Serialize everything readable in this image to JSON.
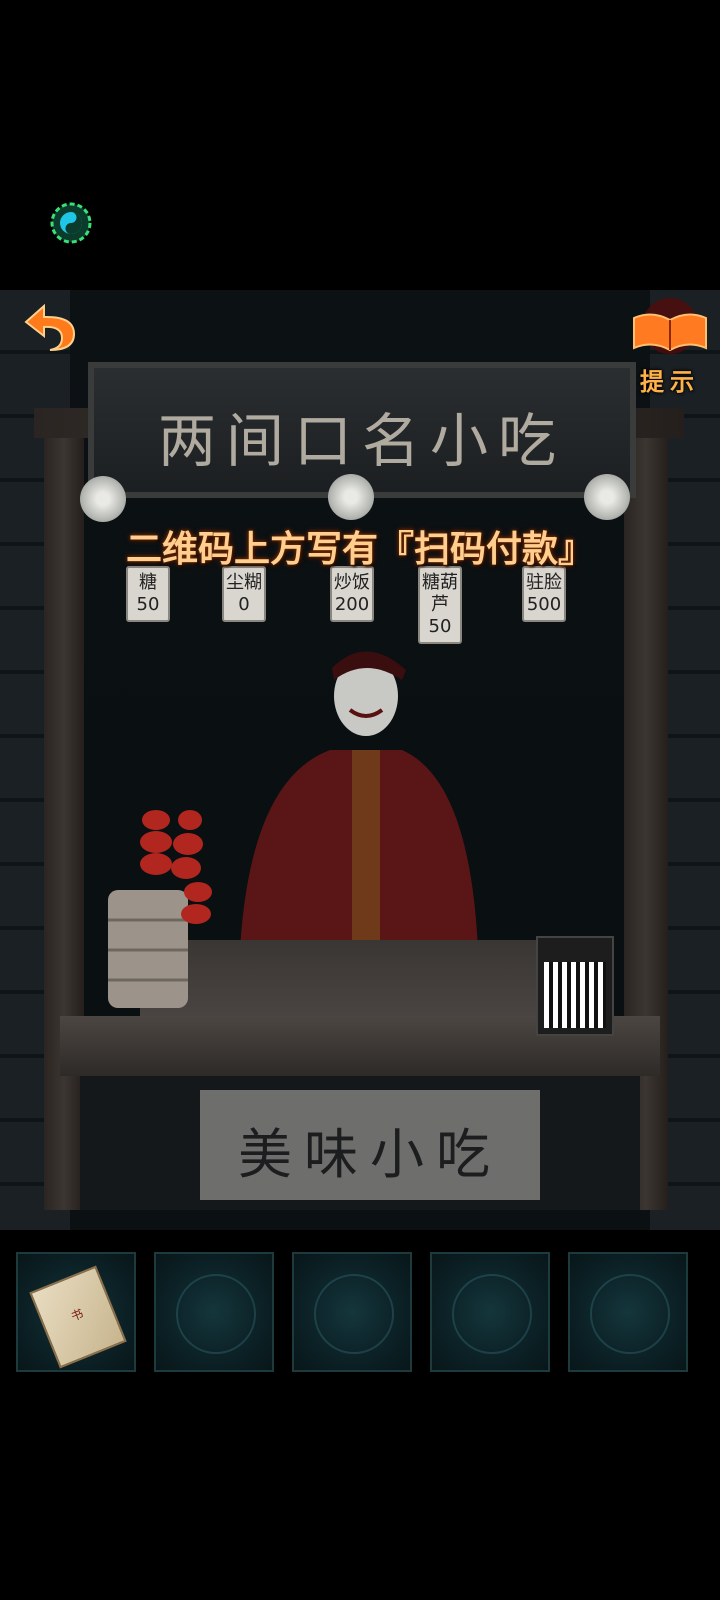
{
  "hud": {
    "settings_icon": "gear-yin-yang-icon",
    "back_icon": "back-arrow-icon",
    "hint_icon": "open-book-icon",
    "hint_label": "提示"
  },
  "scene": {
    "sign_text": "两间口名小吃",
    "menu_tags": [
      {
        "label": "糖",
        "price": "50"
      },
      {
        "label": "尘糊",
        "price": "0"
      },
      {
        "label": "炒饭",
        "price": "200"
      },
      {
        "label": "糖葫芦",
        "price": "50"
      },
      {
        "label": "驻脸",
        "price": "500"
      }
    ],
    "poster_text": "美味小吃",
    "message": "二维码上方写有『扫码付款』"
  },
  "inventory": {
    "slots": [
      {
        "item": "talisman-book",
        "item_label": "书"
      },
      {
        "item": "empty"
      },
      {
        "item": "empty"
      },
      {
        "item": "empty"
      },
      {
        "item": "empty"
      }
    ]
  },
  "colors": {
    "message_text": "#ffcf90",
    "hint_accent": "#ff8a2a",
    "settings_glow": "#2dd4ff"
  }
}
